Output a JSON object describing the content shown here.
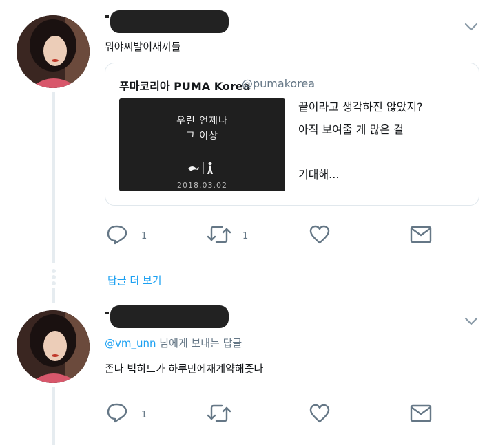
{
  "tweet1": {
    "text": "뭐야씨발이새끼들",
    "card": {
      "name": "푸마코리아 PUMA Korea",
      "handle": "@pumakorea",
      "media_line1": "우린 언제나",
      "media_line2": "그 이상",
      "media_date": "2018.03.02",
      "line1": "끝이라고 생각하진 않았지?",
      "line2": "아직 보여줄 게 많은 걸",
      "line3": "기대해..."
    },
    "actions": {
      "reply_count": "1",
      "retweet_count": "1"
    }
  },
  "show_more_replies": "답글 더 보기",
  "tweet2": {
    "reply_to_handle": "@vm_unn",
    "reply_to_suffix": " 님에게 보내는 답글",
    "text": "존나 빅히트가 하루만에재계약해줏나",
    "actions": {
      "reply_count": "1"
    }
  },
  "colors": {
    "link": "#1da1f2",
    "icon": "#657786",
    "thread_line": "#e6ecf0"
  },
  "icons": [
    "reply-icon",
    "retweet-icon",
    "like-icon",
    "direct-message-icon",
    "chevron-down-icon",
    "puma-logo"
  ]
}
